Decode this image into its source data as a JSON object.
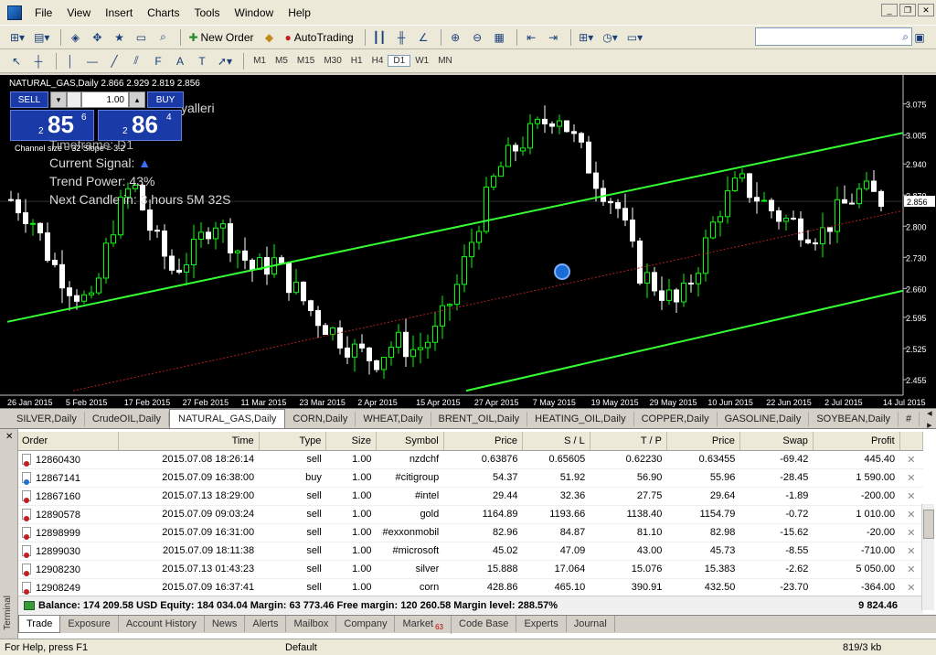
{
  "menu": [
    "File",
    "View",
    "Insert",
    "Charts",
    "Tools",
    "Window",
    "Help"
  ],
  "toolbar": {
    "new_order": "New Order",
    "auto_trading": "AutoTrading"
  },
  "timeframes": [
    "M1",
    "M5",
    "M15",
    "M30",
    "H1",
    "H4",
    "D1",
    "W1",
    "MN"
  ],
  "active_timeframe": "D1",
  "chart": {
    "header": "NATURAL_GAS,Daily  2.866 2.929 2.819 2.856",
    "current_price": "2.856",
    "price_labels": [
      "3.075",
      "3.005",
      "2.940",
      "2.870",
      "2.800",
      "2.730",
      "2.660",
      "2.595",
      "2.525",
      "2.455"
    ],
    "date_labels": [
      "26 Jan 2015",
      "5 Feb 2015",
      "17 Feb 2015",
      "27 Feb 2015",
      "11 Mar 2015",
      "23 Mar 2015",
      "2 Apr 2015",
      "15 Apr 2015",
      "27 Apr 2015",
      "7 May 2015",
      "19 May 2015",
      "29 May 2015",
      "10 Jun 2015",
      "22 Jun 2015",
      "2 Jul 2015",
      "14 Jul 2015"
    ],
    "trade_panel": {
      "sell": "SELL",
      "buy": "BUY",
      "lot": "1.00",
      "sell_prefix": "2",
      "sell_big": "85",
      "sell_sup": "6",
      "buy_prefix": "2",
      "buy_big": "86",
      "buy_sup": "4"
    },
    "channel_size": "Channel size = 32 Slope = 3.2",
    "indicator": {
      "fragment": "yalleri",
      "timeframe": "Timeframe: D1",
      "signal": "Current Signal:",
      "power": "Trend Power: 43%",
      "next_candle": "Next Candle in: 3 hours 5M 32S"
    },
    "colors": {
      "bull": "#00ff00",
      "bear": "#ffffff",
      "trendline": "#33ff33",
      "midline": "#b02020"
    }
  },
  "symbol_tabs": [
    "SILVER,Daily",
    "CrudeOIL,Daily",
    "NATURAL_GAS,Daily",
    "CORN,Daily",
    "WHEAT,Daily",
    "BRENT_OIL,Daily",
    "HEATING_OIL,Daily",
    "COPPER,Daily",
    "GASOLINE,Daily",
    "SOYBEAN,Daily",
    "#"
  ],
  "active_symbol_tab": "NATURAL_GAS,Daily",
  "orders": {
    "columns": [
      "Order",
      "Time",
      "Type",
      "Size",
      "Symbol",
      "Price",
      "S / L",
      "T / P",
      "Price",
      "Swap",
      "Profit"
    ],
    "rows": [
      [
        "12860430",
        "2015.07.08 18:26:14",
        "sell",
        "1.00",
        "nzdchf",
        "0.63876",
        "0.65605",
        "0.62230",
        "0.63455",
        "-69.42",
        "445.40"
      ],
      [
        "12867141",
        "2015.07.09 16:38:00",
        "buy",
        "1.00",
        "#citigroup",
        "54.37",
        "51.92",
        "56.90",
        "55.96",
        "-28.45",
        "1 590.00"
      ],
      [
        "12867160",
        "2015.07.13 18:29:00",
        "sell",
        "1.00",
        "#intel",
        "29.44",
        "32.36",
        "27.75",
        "29.64",
        "-1.89",
        "-200.00"
      ],
      [
        "12890578",
        "2015.07.09 09:03:24",
        "sell",
        "1.00",
        "gold",
        "1164.89",
        "1193.66",
        "1138.40",
        "1154.79",
        "-0.72",
        "1 010.00"
      ],
      [
        "12898999",
        "2015.07.09 16:31:00",
        "sell",
        "1.00",
        "#exxonmobil",
        "82.96",
        "84.87",
        "81.10",
        "82.98",
        "-15.62",
        "-20.00"
      ],
      [
        "12899030",
        "2015.07.09 18:11:38",
        "sell",
        "1.00",
        "#microsoft",
        "45.02",
        "47.09",
        "43.00",
        "45.73",
        "-8.55",
        "-710.00"
      ],
      [
        "12908230",
        "2015.07.13 01:43:23",
        "sell",
        "1.00",
        "silver",
        "15.888",
        "17.064",
        "15.076",
        "15.383",
        "-2.62",
        "5 050.00"
      ],
      [
        "12908249",
        "2015.07.09 16:37:41",
        "sell",
        "1.00",
        "corn",
        "428.86",
        "465.10",
        "390.91",
        "432.50",
        "-23.70",
        "-364.00"
      ]
    ],
    "balance_line": "Balance: 174 209.58 USD  Equity: 184 034.04  Margin: 63 773.46  Free margin: 120 260.58  Margin level: 288.57%",
    "total_profit": "9 824.46"
  },
  "terminal_tabs": [
    "Trade",
    "Exposure",
    "Account History",
    "News",
    "Alerts",
    "Mailbox",
    "Company",
    "Market",
    "Code Base",
    "Experts",
    "Journal"
  ],
  "active_terminal_tab": "Trade",
  "market_badge": "63",
  "terminal_label": "Terminal",
  "status": {
    "help": "For Help, press F1",
    "profile": "Default",
    "traffic": "819/3 kb"
  }
}
